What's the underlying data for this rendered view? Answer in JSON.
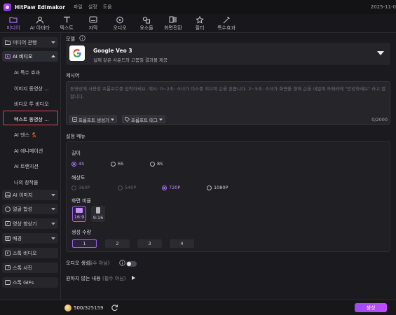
{
  "app": {
    "title": "HitPaw Edimakor",
    "menu": [
      "파일",
      "설정",
      "도움"
    ],
    "clock": "2025-11-0"
  },
  "toolbar": {
    "tabs": [
      {
        "label": "미디어",
        "icon": "folder-icon",
        "active": true
      },
      {
        "label": "AI 아바타",
        "icon": "avatar-icon",
        "active": false
      },
      {
        "label": "텍스트",
        "icon": "text-icon",
        "active": false
      },
      {
        "label": "자막",
        "icon": "subtitle-icon",
        "active": false
      },
      {
        "label": "오디오",
        "icon": "audio-icon",
        "active": false
      },
      {
        "label": "요소들",
        "icon": "elements-icon",
        "active": false
      },
      {
        "label": "화면전환",
        "icon": "transition-icon",
        "active": false
      },
      {
        "label": "필터",
        "icon": "filter-icon",
        "active": false
      },
      {
        "label": "특수효과",
        "icon": "effects-icon",
        "active": false
      }
    ],
    "accent": "#b06bff"
  },
  "sidebar": {
    "media_import": "미디어 관행",
    "ai_video": "AI 비디오",
    "sub_items": [
      "AI 특수 효과",
      "이미지 동영상 ...",
      "비디오 투 비디오",
      "텍스트 동영상 ...",
      "AI 댄스 💃",
      "AI 애니메이션",
      "AI 트랜지션",
      "나의 창작물"
    ],
    "selected_sub": "텍스트 동영상 ...",
    "groups": [
      "AI 이미지",
      "얼굴 합성",
      "영상 향상기",
      "배경"
    ],
    "stock": [
      "스톡 비디오",
      "스톡 사진",
      "스톡 GIFs"
    ]
  },
  "main": {
    "model_label": "모델",
    "model_name": "Google Veo 3",
    "model_desc": "실제 같은 사운드와 고품질 결과물 제공",
    "prompt_label": "제시어",
    "prompt_placeholder": "동영상에 사용할 프롬프트를 입력하세요. 예시: 0~2초: 소녀가 미소를 지으며 손을 흔듭니다. 2~5초: 소녀가 화면을 향해 손을 내밀며 카메라에 \"안녕하세요\" 라고 말합니다.",
    "prompt_gen_button": "프롬프트 생성기",
    "prompt_tag_button": "프롬프트 태그",
    "char_count": "0/2000",
    "settings_label": "설정 메뉴",
    "length_label": "길이",
    "length_options": [
      "4S",
      "6S",
      "8S"
    ],
    "length_selected": "4S",
    "resolution_label": "해상도",
    "resolution_options": [
      "360P",
      "540P",
      "720P",
      "1080P"
    ],
    "resolution_selected": "720P",
    "resolution_disabled": [
      "360P",
      "540P"
    ],
    "aspect_label": "화면 비율",
    "aspect_options": [
      "16:9",
      "9:16"
    ],
    "aspect_selected": "16:9",
    "count_label": "생성 수량",
    "count_options": [
      "1",
      "2",
      "3",
      "4"
    ],
    "count_selected": "1",
    "audio_gen_label": "오디오 생성",
    "audio_gen_hint": "(필수 아님)",
    "audio_gen_on": false,
    "negative_label": "원하지 않는 내용",
    "negative_hint": "(필수 아님)"
  },
  "footer": {
    "credits": "500",
    "credits_total": "/325159",
    "generate_button": "생성"
  }
}
